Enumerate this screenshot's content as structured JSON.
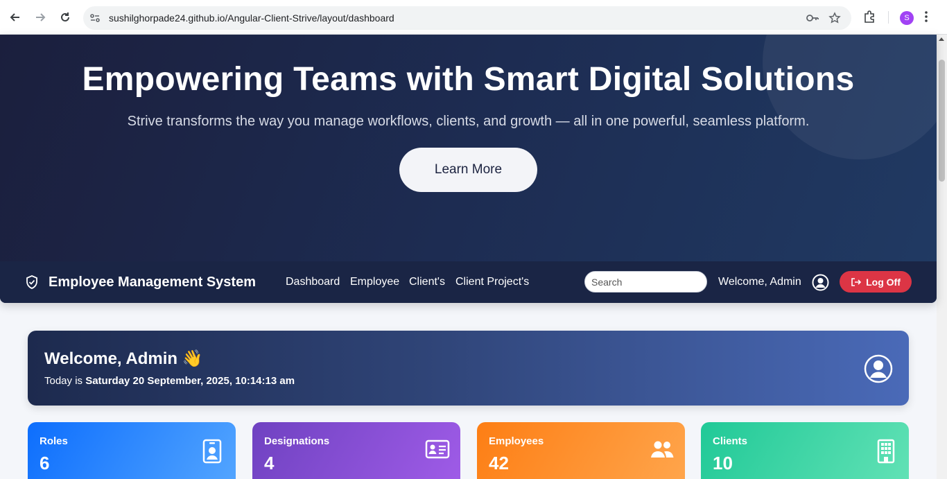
{
  "browser": {
    "url": "sushilghorpade24.github.io/Angular-Client-Strive/layout/dashboard",
    "profile_initial": "S"
  },
  "hero": {
    "title": "Empowering Teams with Smart Digital Solutions",
    "subtitle": "Strive transforms the way you manage workflows, clients, and growth — all in one powerful, seamless platform.",
    "cta_label": "Learn More"
  },
  "navbar": {
    "brand": "Employee Management System",
    "links": [
      "Dashboard",
      "Employee",
      "Client's",
      "Client Project's"
    ],
    "search_placeholder": "Search",
    "welcome": "Welcome, Admin",
    "logoff_label": "Log Off"
  },
  "welcome_card": {
    "greeting": "Welcome, Admin 👋",
    "date_prefix": "Today is ",
    "date_value": "Saturday 20 September, 2025, 10:14:13 am"
  },
  "stats": [
    {
      "label": "Roles",
      "value": "6",
      "icon": "id-badge-icon",
      "color": "#0d6efd"
    },
    {
      "label": "Designations",
      "value": "4",
      "icon": "id-card-icon",
      "color": "#6f42c1"
    },
    {
      "label": "Employees",
      "value": "42",
      "icon": "people-icon",
      "color": "#fd7e14"
    },
    {
      "label": "Clients",
      "value": "10",
      "icon": "building-icon",
      "color": "#20c997"
    }
  ],
  "colors": {
    "hero_bg": "#1d2c52",
    "navbar_bg": "#1a2545",
    "logoff": "#dc3545"
  }
}
